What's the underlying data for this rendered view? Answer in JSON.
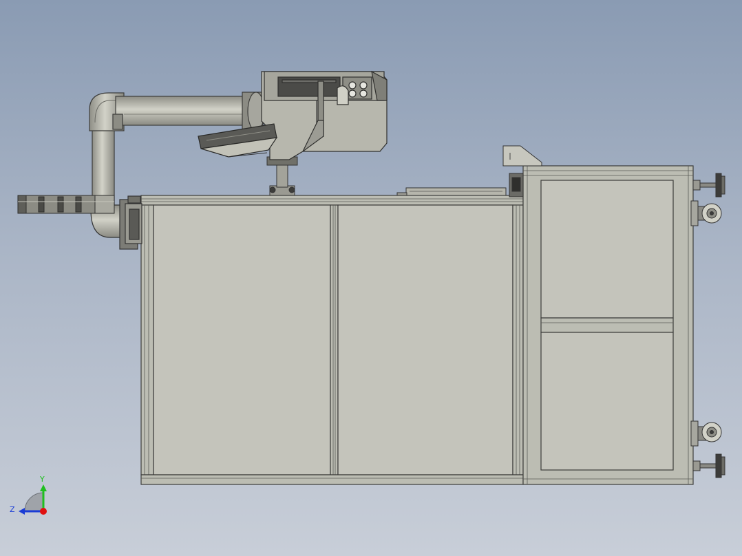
{
  "view": {
    "background_top": "#8a9bb3",
    "background_bottom": "#c8ced8"
  },
  "triad": {
    "y_label": "Y",
    "z_label": "Z",
    "y_color": "#1fbf1f",
    "z_color": "#1a3cd6",
    "x_color": "#e01010"
  },
  "model": {
    "frame_color": "#bfc0b6",
    "panel_color": "#c3c3ba",
    "arm_color": "#b8b8ae",
    "dark_color": "#4a4a48"
  }
}
